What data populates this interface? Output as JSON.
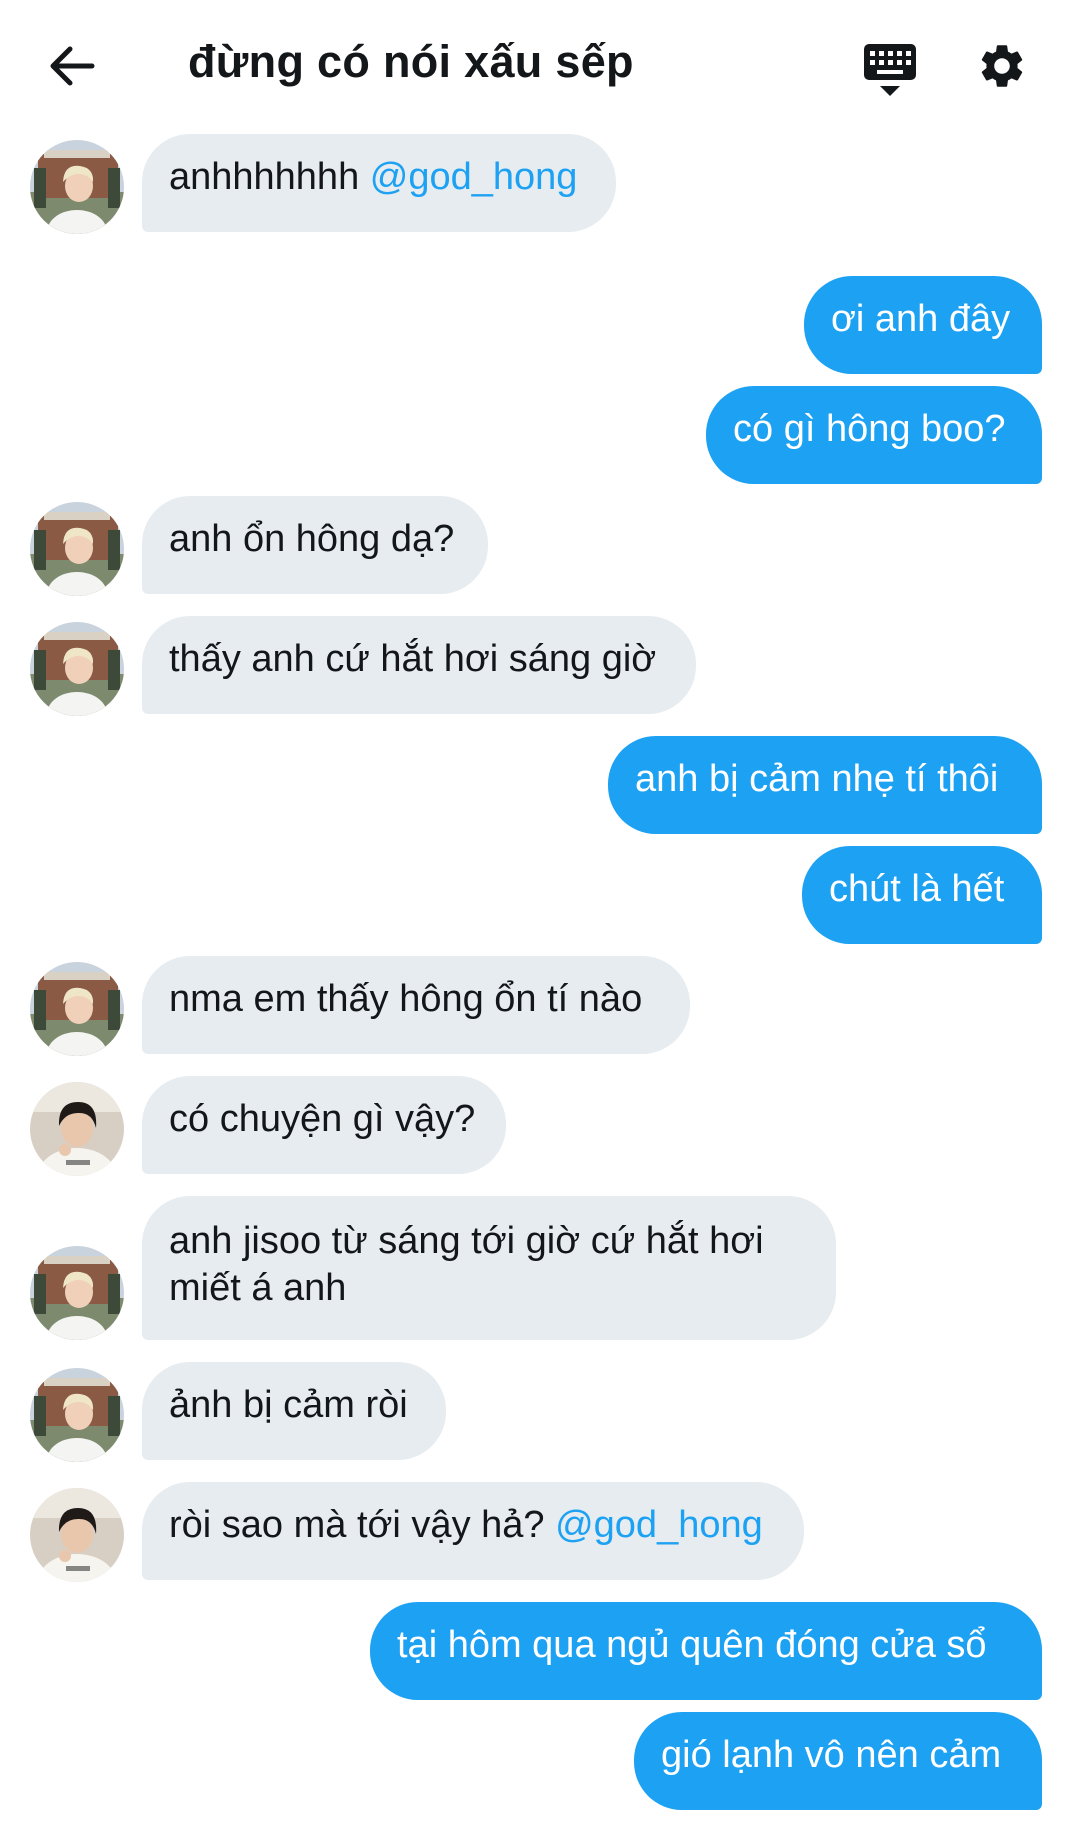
{
  "header": {
    "title": "đừng có nói xấu sếp",
    "icons": [
      "back-arrow-icon",
      "keyboard-icon",
      "gear-icon"
    ]
  },
  "colors": {
    "incoming_bubble": "#e6ecf0",
    "outgoing_bubble": "#1da1f2",
    "mention": "#1da1f2"
  },
  "messages": [
    {
      "direction": "incoming",
      "sender": "blond",
      "text": "anhhhhhhh ",
      "mention": "@god_hong"
    },
    {
      "direction": "outgoing",
      "text": "ơi anh đây"
    },
    {
      "direction": "outgoing",
      "text": "có gì hông boo?"
    },
    {
      "direction": "incoming",
      "sender": "blond",
      "text": "anh ổn hông dạ?"
    },
    {
      "direction": "incoming",
      "sender": "blond",
      "text": "thấy anh cứ hắt hơi sáng giờ"
    },
    {
      "direction": "outgoing",
      "text": "anh bị cảm nhẹ tí thôi"
    },
    {
      "direction": "outgoing",
      "text": "chút là hết"
    },
    {
      "direction": "incoming",
      "sender": "blond",
      "text": "nma em thấy hông ổn tí nào"
    },
    {
      "direction": "incoming",
      "sender": "dark",
      "text": "có chuyện gì vậy?"
    },
    {
      "direction": "incoming",
      "sender": "blond",
      "text": "anh jisoo từ sáng tới giờ cứ hắt hơi miết á anh"
    },
    {
      "direction": "incoming",
      "sender": "blond",
      "text": "ảnh bị cảm ròi"
    },
    {
      "direction": "incoming",
      "sender": "dark",
      "text": "ròi sao mà tới vậy hả? ",
      "mention": "@god_hong"
    },
    {
      "direction": "outgoing",
      "text": "tại hôm qua ngủ quên đóng cửa sổ"
    },
    {
      "direction": "outgoing",
      "text": "gió lạnh vô nên cảm"
    }
  ]
}
